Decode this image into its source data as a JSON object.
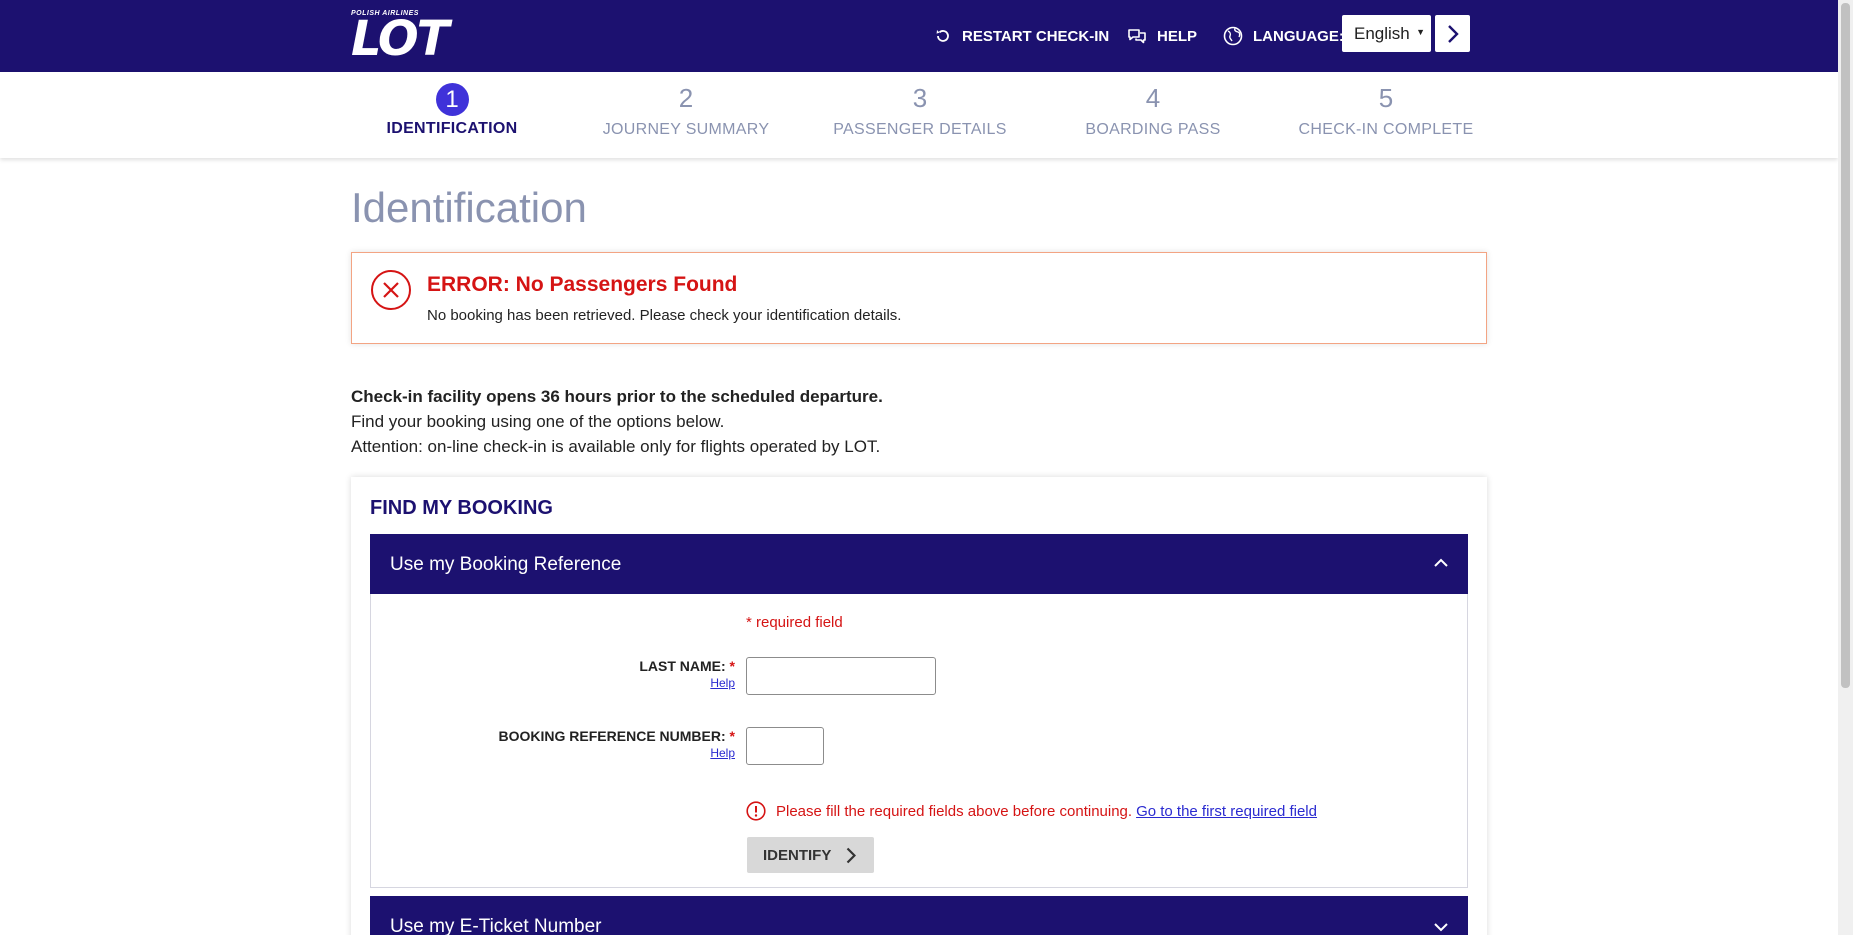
{
  "header": {
    "logo_small": "POLISH AIRLINES",
    "logo_text": "LOT",
    "restart_label": "RESTART CHECK-IN",
    "help_label": "HELP",
    "language_label": "LANGUAGE:",
    "language_value": "English"
  },
  "steps": [
    {
      "num": "1",
      "label": "IDENTIFICATION",
      "active": true
    },
    {
      "num": "2",
      "label": "JOURNEY SUMMARY",
      "active": false
    },
    {
      "num": "3",
      "label": "PASSENGER DETAILS",
      "active": false
    },
    {
      "num": "4",
      "label": "BOARDING PASS",
      "active": false
    },
    {
      "num": "5",
      "label": "CHECK-IN COMPLETE",
      "active": false
    }
  ],
  "page": {
    "title": "Identification"
  },
  "error": {
    "title": "ERROR: No Passengers Found",
    "message": "No booking has been retrieved. Please check your identification details."
  },
  "info": {
    "line1": "Check-in facility opens 36 hours prior to the scheduled departure.",
    "line2": "Find your booking using one of the options below.",
    "line3": "Attention: on-line check-in is available only for flights operated by LOT."
  },
  "find_booking": {
    "title": "FIND MY BOOKING",
    "section1_label": "Use my Booking Reference",
    "required_note": "* required field",
    "last_name_label": "LAST NAME:",
    "booking_ref_label": "BOOKING REFERENCE NUMBER:",
    "required_star": "*",
    "help_label": "Help",
    "last_name_value": "",
    "booking_ref_value": "",
    "validation_msg": "Please fill the required fields above before continuing.",
    "validation_link": "Go to the first required field",
    "identify_label": "IDENTIFY",
    "section2_label": "Use my E-Ticket Number"
  },
  "colors": {
    "brand": "#1c1170",
    "active_step": "#3f32d9",
    "error": "#d51414",
    "error_border": "#f3a483"
  }
}
